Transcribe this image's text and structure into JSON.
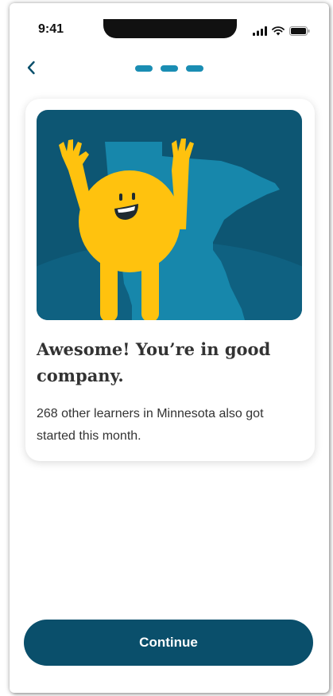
{
  "status_bar": {
    "time": "9:41"
  },
  "icons": {
    "back": "chevron-left-icon",
    "signal": "cellular-signal-icon",
    "wifi": "wifi-icon",
    "battery": "battery-icon"
  },
  "progress": {
    "total_steps": 3,
    "completed_steps": 3
  },
  "card": {
    "title": "Awesome! You’re in good company.",
    "body": "268 other learners in Minnesota also got started this month."
  },
  "continue_button": {
    "label": "Continue"
  },
  "colors": {
    "primary_dark": "#0a4f6b",
    "accent_blue": "#1a8db3",
    "illustration_bg": "#0d5673",
    "map_blue": "#1787ab",
    "mascot_yellow": "#ffc20e",
    "text": "#333333"
  }
}
